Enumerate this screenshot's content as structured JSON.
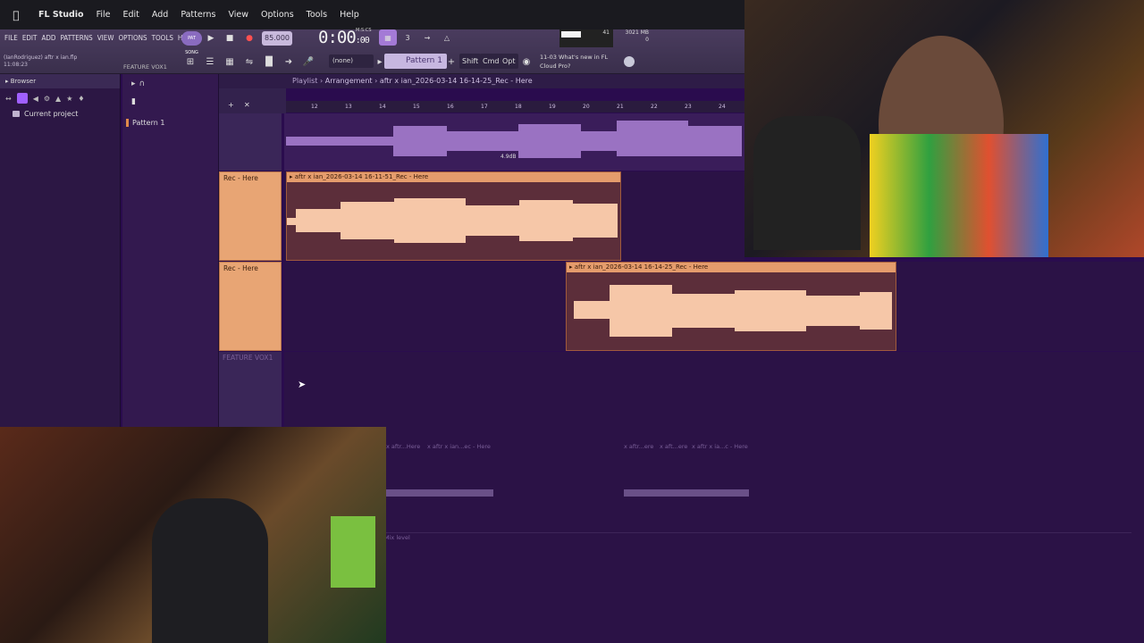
{
  "macbar": {
    "app": "FL Studio",
    "menus": [
      "File",
      "Edit",
      "Add",
      "Patterns",
      "View",
      "Options",
      "Tools",
      "Help"
    ]
  },
  "fl_menu": {
    "items": [
      "FILE",
      "EDIT",
      "ADD",
      "PATTERNS",
      "VIEW",
      "OPTIONS",
      "TOOLS",
      "HELP"
    ],
    "project_name": "(IanRodriguez) aftr x ian.flp",
    "project_time": "11:08:23",
    "hint_text": "FEATURE VOX1",
    "pat_label": "PAT SONG"
  },
  "transport": {
    "tempo": "85.000",
    "time_main": "0:00",
    "time_sub": ":00",
    "time_sig": "M:S:CS",
    "mode_beat": "3",
    "meter_value": "41",
    "memory_mb": "3021 MB",
    "memory_sub": "0"
  },
  "toolbar2": {
    "none_select": "(none)",
    "pattern_select": "Pattern 1",
    "shift": "Shift",
    "cmd": "Cmd",
    "opt": "Opt",
    "news_date": "11-03",
    "news_line1": "What's new in FL",
    "news_line2": "Cloud Pro?"
  },
  "browser": {
    "title": "Browser",
    "item_current_project": "Current project"
  },
  "picker": {
    "pattern": "Pattern 1"
  },
  "playlist": {
    "breadcrumb_1": "Playlist",
    "breadcrumb_2": "Arrangement",
    "breadcrumb_3": "aftr x ian_2026-03-14 16-14-25_Rec - Here",
    "ruler": [
      "12",
      "13",
      "14",
      "15",
      "16",
      "17",
      "18",
      "19",
      "20",
      "21",
      "22",
      "23",
      "24"
    ],
    "db_label": "4.9dB",
    "track2_label": "Rec - Here",
    "track3_label": "Rec - Here",
    "track4_label": "FEATURE VOX1",
    "clip1_title": "aftr x ian_2026-03-14 16-11-51_Rec - Here",
    "clip2_title": "aftr x ian_2026-03-14 16-14-25_Rec - Here",
    "ghost_clips": [
      "x aftr...Here",
      "x aftr x ian...ec - Here",
      "x aftr...ere",
      "x aft...ere",
      "x aftr x ia...c - Here"
    ],
    "mix_level": "Mix level"
  },
  "colors": {
    "accent_purple": "#a060ff",
    "clip_header": "#e59c6c",
    "waveform": "#f6c7a8",
    "background": "#2a0c4e"
  }
}
